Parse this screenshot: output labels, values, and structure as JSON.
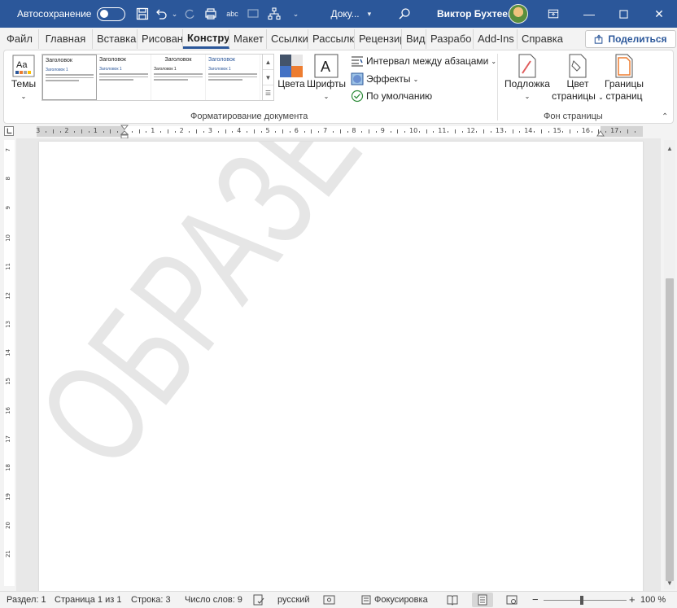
{
  "titlebar": {
    "autosave_label": "Автосохранение",
    "doc_name": "Доку...",
    "user_name": "Виктор Бухтеев",
    "accent": "#2b579a"
  },
  "tabs": [
    {
      "label": "Файл"
    },
    {
      "label": "Главная"
    },
    {
      "label": "Вставка"
    },
    {
      "label": "Рисовани"
    },
    {
      "label": "Констру",
      "active": true
    },
    {
      "label": "Макет"
    },
    {
      "label": "Ссылки"
    },
    {
      "label": "Рассылк"
    },
    {
      "label": "Рецензир"
    },
    {
      "label": "Вид"
    },
    {
      "label": "Разрабо"
    },
    {
      "label": "Add-Ins"
    },
    {
      "label": "Справка"
    }
  ],
  "share_label": "Поделиться",
  "ribbon": {
    "themes_label": "Темы",
    "gallery": [
      {
        "title": "Заголовок",
        "heading": "Заголовок 1"
      },
      {
        "title": "Заголовок",
        "heading": "Заголовок 1"
      },
      {
        "title": "Заголовок",
        "heading": "Заголовок 1"
      },
      {
        "title": "Заголовок",
        "heading": "Заголовок 1"
      }
    ],
    "colors_label": "Цвета",
    "fonts_label": "Шрифты",
    "spacing_label": "Интервал между абзацами",
    "effects_label": "Эффекты",
    "default_label": "По умолчанию",
    "doc_format_group": "Форматирование документа",
    "watermark_label": "Подложка",
    "page_color_line1": "Цвет",
    "page_color_line2": "страницы",
    "page_borders_line1": "Границы",
    "page_borders_line2": "страниц",
    "page_bg_group": "Фон страницы"
  },
  "document": {
    "watermark_text": "ОБРАЗЕЦ"
  },
  "statusbar": {
    "section": "Раздел: 1",
    "page": "Страница 1 из 1",
    "line": "Строка: 3",
    "words": "Число слов: 9",
    "language": "русский",
    "focus": "Фокусировка",
    "zoom": "100 %",
    "zoom_value": 100
  },
  "ruler": {
    "h_labels": [
      "3",
      "2",
      "1",
      "1",
      "2",
      "3",
      "4",
      "5",
      "6",
      "7",
      "8",
      "9",
      "10",
      "11",
      "12",
      "13",
      "14",
      "15",
      "16",
      "17"
    ],
    "v_labels": [
      "7",
      "8",
      "9",
      "10",
      "11",
      "12",
      "13",
      "14",
      "15",
      "16",
      "17",
      "18",
      "19",
      "20",
      "21"
    ]
  }
}
